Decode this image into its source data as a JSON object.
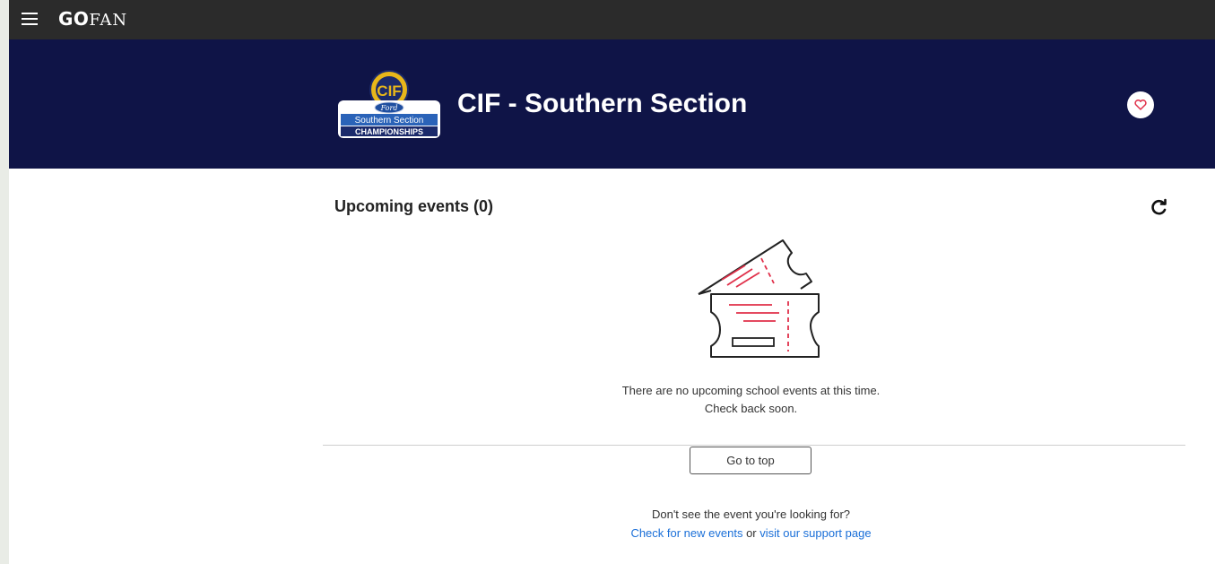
{
  "nav": {
    "brand_go": "GO",
    "brand_fan": "FAN"
  },
  "banner": {
    "org_name": "CIF - Southern Section",
    "logo": {
      "top": "CIF",
      "sponsor": "Ford",
      "line1": "Southern Section",
      "line2": "CHAMPIONSHIPS"
    }
  },
  "events": {
    "title": "Upcoming events (0)",
    "empty_line1": "There are no upcoming school events at this time.",
    "empty_line2": "Check back soon."
  },
  "actions": {
    "go_to_top": "Go to top"
  },
  "help": {
    "question": "Don't see the event you're looking for?",
    "check_link": "Check for new events",
    "or": " or ",
    "support_link": "visit our support page"
  },
  "colors": {
    "banner_bg": "#0f1447",
    "topbar_bg": "#2b2b2b",
    "accent_red": "#e0304a",
    "link_blue": "#1a6fd8"
  },
  "icons": [
    "menu-icon",
    "heart-icon",
    "refresh-icon",
    "ticket-illustration"
  ]
}
